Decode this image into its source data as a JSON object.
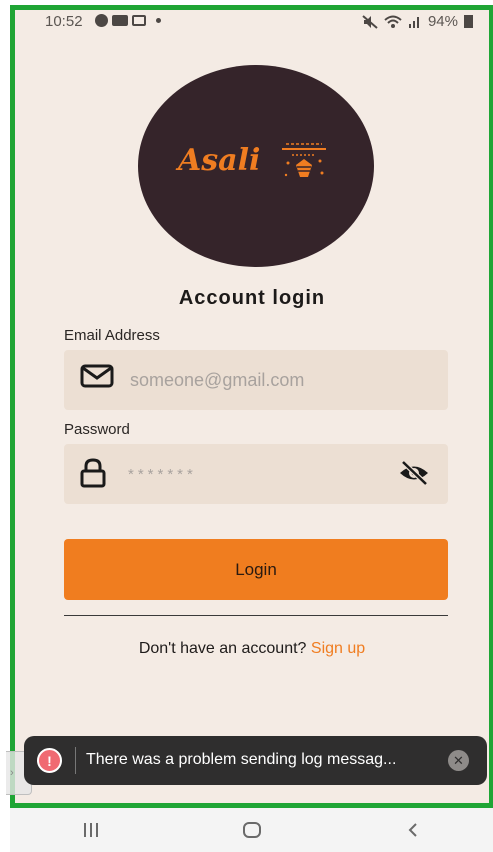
{
  "status_bar": {
    "time": "10:52",
    "battery": "94%"
  },
  "logo": {
    "text": "Asali",
    "bee_icon": "bee-hive-icon"
  },
  "login": {
    "title": "Account login",
    "email_label": "Email Address",
    "email_placeholder": "someone@gmail.com",
    "password_label": "Password",
    "password_value": "*******",
    "button_label": "Login",
    "signup_prompt": "Don't have an account?",
    "signup_link": "Sign up"
  },
  "toast": {
    "message": "There was a problem sending log messag..."
  },
  "colors": {
    "background": "#f4ebe4",
    "accent": "#f07d1f",
    "logo_circle": "#35242a",
    "input_bg": "#ecdfd3",
    "frame_border": "#1fa535"
  },
  "icons": {
    "email": "mail-icon",
    "password": "lock-icon",
    "visibility": "eye-off-icon",
    "toast_error": "error-icon",
    "toast_close": "close-icon"
  }
}
